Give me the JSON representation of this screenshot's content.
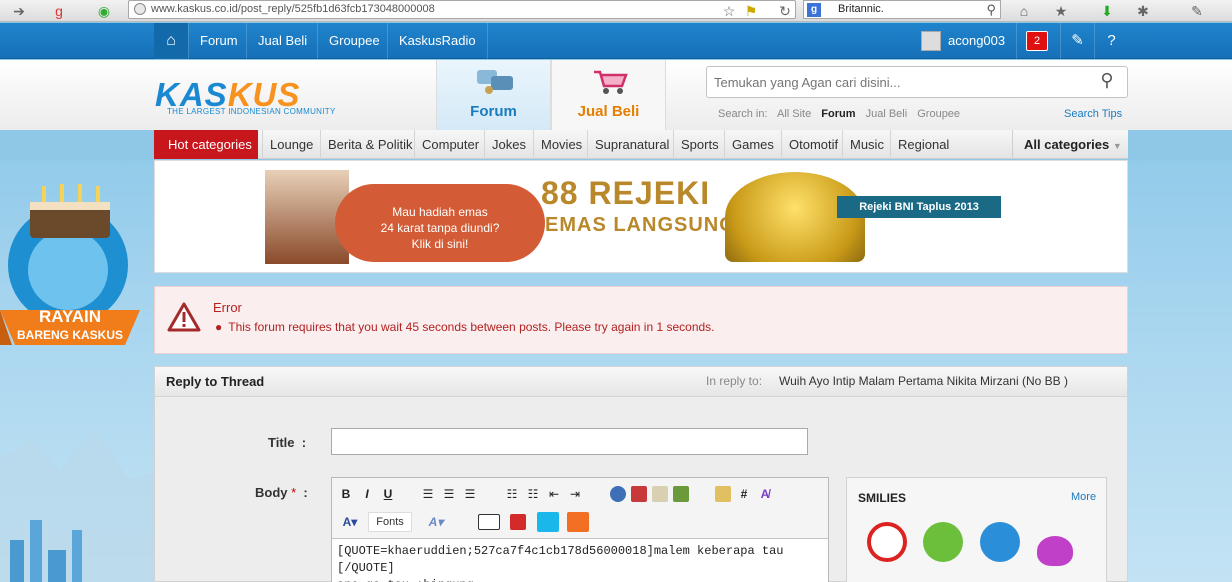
{
  "browser": {
    "url": "www.kaskus.co.id/post_reply/525fb1d63fcb173048000008",
    "search_engine": "g",
    "search_value": "Britannic."
  },
  "topnav": {
    "items": [
      "Forum",
      "Jual Beli",
      "Groupee",
      "KaskusRadio"
    ],
    "username": "acong003",
    "notification_count": "2"
  },
  "header": {
    "logo_text_1": "KAS",
    "logo_text_2": "KUS",
    "logo_tagline": "THE LARGEST INDONESIAN COMMUNITY",
    "tab_forum": "Forum",
    "tab_jualbeli": "Jual Beli",
    "search_placeholder": "Temukan yang Agan cari disini...",
    "search_in_label": "Search in:",
    "search_in_options": [
      "All Site",
      "Forum",
      "Jual Beli",
      "Groupee"
    ],
    "search_tips": "Search Tips"
  },
  "categories": {
    "hot": "Hot categories",
    "items": [
      "Lounge",
      "Berita & Politik",
      "Computer",
      "Jokes",
      "Movies",
      "Supranatural",
      "Sports",
      "Games",
      "Otomotif",
      "Music",
      "Regional"
    ],
    "all": "All categories"
  },
  "mascot": {
    "line1": "RAYAIN",
    "line2": "BARENG KASKUS"
  },
  "banner": {
    "bubble_text_1": "Mau hadiah emas",
    "bubble_text_2": "24 karat tanpa diundi?",
    "bubble_text_3": "Klik di sini!",
    "headline_1": "88 REJEKI",
    "headline_2": "EMAS LANGSUNG",
    "badge": "Rejeki BNI Taplus 2013"
  },
  "error": {
    "title": "Error",
    "message": "This forum requires that you wait 45 seconds between posts. Please try again in 1 seconds."
  },
  "reply": {
    "heading": "Reply to Thread",
    "in_reply_to_label": "In reply to:",
    "thread_title": "Wuih Ayo Intip Malam Pertama Nikita Mirzani (No BB )",
    "title_label": "Title",
    "body_label": "Body",
    "title_value": "",
    "body_value": "[QUOTE=khaeruddien;527ca7f4c1cb178d56000018]malem keberapa tau [/QUOTE]\nane ga tau :bingung",
    "fonts_label": "Fonts"
  },
  "smilies": {
    "title": "SMILIES",
    "more": "More"
  },
  "colors": {
    "brand_blue": "#1a89d1",
    "brand_orange": "#f7921e",
    "hot_red": "#c8161d",
    "error_red": "#b22222"
  }
}
